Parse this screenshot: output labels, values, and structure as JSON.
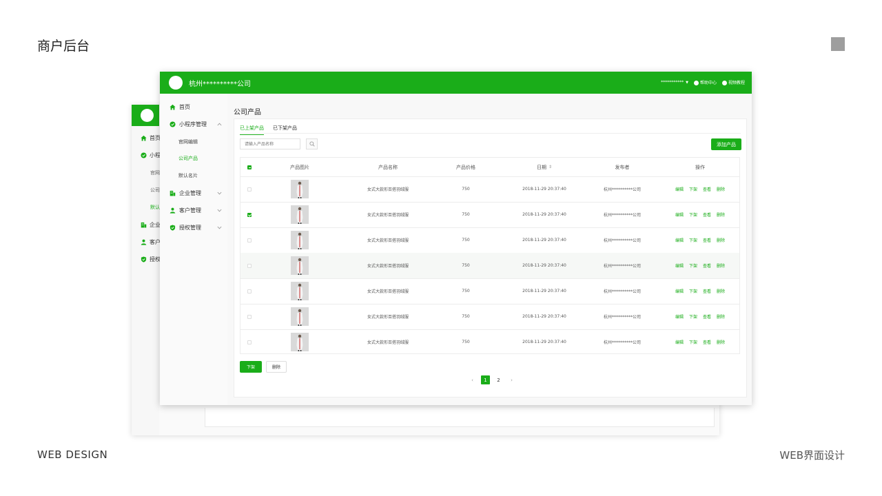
{
  "slide": {
    "title": "商户后台",
    "footer_left": "WEB DESIGN",
    "footer_right": "WEB界面设计"
  },
  "colors": {
    "brand": "#1aad19",
    "thumbnail": "#d7d7d7"
  },
  "back_window": {
    "nav": [
      {
        "label": "首页",
        "icon": "home-icon"
      },
      {
        "label": "小程",
        "icon": "check-circle-icon"
      },
      {
        "label": "官网",
        "sub": true
      },
      {
        "label": "公司",
        "sub": true
      },
      {
        "label": "默认",
        "sub": true,
        "active": true
      },
      {
        "label": "企业",
        "icon": "building-icon"
      },
      {
        "label": "客户",
        "icon": "user-icon"
      },
      {
        "label": "授权",
        "icon": "shield-icon"
      }
    ]
  },
  "header": {
    "company": "杭州**********公司",
    "account": "***********",
    "help": "帮助中心",
    "video": "视频教程"
  },
  "sidebar": {
    "items": [
      {
        "label": "首页",
        "icon": "home-icon"
      },
      {
        "label": "小程序管理",
        "icon": "check-circle-icon",
        "expanded": true
      },
      {
        "label": "官网编辑",
        "sub": true
      },
      {
        "label": "公司产品",
        "sub": true,
        "active": true
      },
      {
        "label": "默认名片",
        "sub": true
      },
      {
        "label": "企业管理",
        "icon": "building-icon"
      },
      {
        "label": "客户管理",
        "icon": "user-icon"
      },
      {
        "label": "授权管理",
        "icon": "shield-icon"
      }
    ]
  },
  "main": {
    "page_title": "公司产品",
    "tabs": [
      "已上架产品",
      "已下架产品"
    ],
    "search_placeholder": "请输入产品名称",
    "add_button": "添加产品",
    "columns": [
      "产品图片",
      "产品名称",
      "产品价格",
      "日期",
      "发布者",
      "操作"
    ],
    "date_sort_icon": "⇕",
    "operations": [
      "编辑",
      "下架",
      "查看",
      "删除"
    ],
    "rows": [
      {
        "name": "女式大款形百搭羽绒服",
        "price": "750",
        "date": "2018-11-29 20:37:40",
        "publisher": "杭州**********公司",
        "checked": false
      },
      {
        "name": "女式大款形百搭羽绒服",
        "price": "750",
        "date": "2018-11-29 20:37:40",
        "publisher": "杭州**********公司",
        "checked": true
      },
      {
        "name": "女式大款形百搭羽绒服",
        "price": "750",
        "date": "2018-11-29 20:37:40",
        "publisher": "杭州**********公司",
        "checked": false
      },
      {
        "name": "女式大款形百搭羽绒服",
        "price": "750",
        "date": "2018-11-29 20:37:40",
        "publisher": "杭州**********公司",
        "checked": false,
        "highlighted": true
      },
      {
        "name": "女式大款形百搭羽绒服",
        "price": "750",
        "date": "2018-11-29 20:37:40",
        "publisher": "杭州**********公司",
        "checked": false
      },
      {
        "name": "女式大款形百搭羽绒服",
        "price": "750",
        "date": "2018-11-29 20:37:40",
        "publisher": "杭州**********公司",
        "checked": false
      },
      {
        "name": "女式大款形百搭羽绒服",
        "price": "750",
        "date": "2018-11-29 20:37:40",
        "publisher": "杭州**********公司",
        "checked": false
      }
    ],
    "bottom_buttons": {
      "offline": "下架",
      "delete": "删除"
    },
    "pagination": {
      "prev": "‹",
      "pages": [
        "1",
        "2"
      ],
      "current": "1",
      "next": "›"
    }
  }
}
